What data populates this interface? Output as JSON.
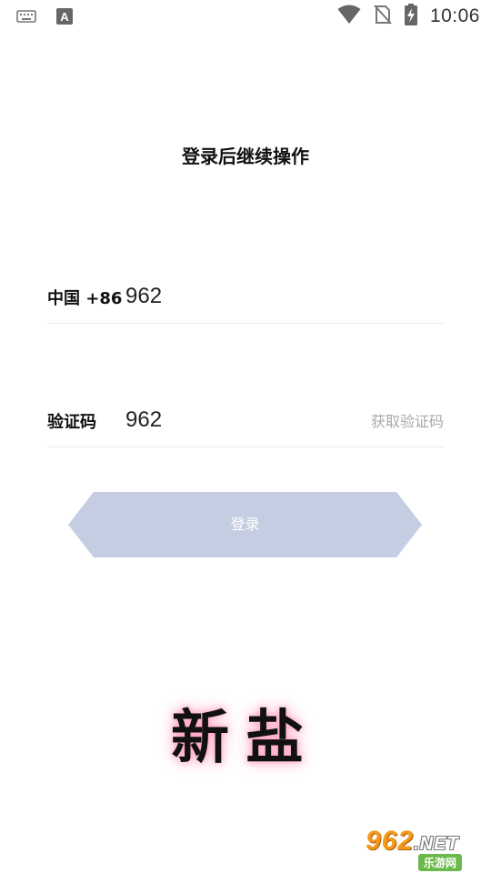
{
  "status_bar": {
    "time": "10:06",
    "icons": [
      "keyboard-icon",
      "a-text-icon",
      "wifi-icon",
      "no-sim-icon",
      "battery-charging-icon"
    ]
  },
  "page": {
    "title": "登录后继续操作"
  },
  "phone_row": {
    "label": "中国 +86",
    "value": "962",
    "placeholder": ""
  },
  "code_row": {
    "label": "验证码",
    "value": "962",
    "get_code_label": "获取验证码"
  },
  "login_button": {
    "label": "登录",
    "color": "#c5cde2"
  },
  "brand": {
    "logo_text": "新盐"
  },
  "watermark": {
    "num": "962",
    "net": ".NET",
    "site": "乐游网"
  }
}
